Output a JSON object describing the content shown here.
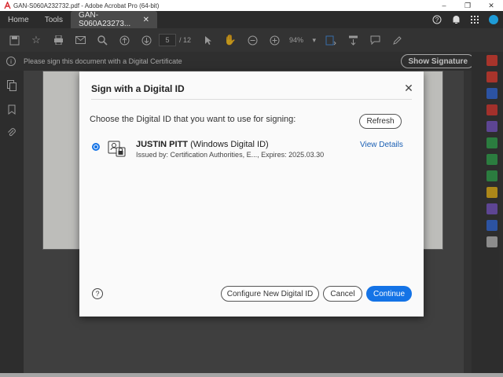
{
  "window": {
    "title": "GAN-S060A232732.pdf - Adobe Acrobat Pro (64-bit)",
    "minimize": "–",
    "maximize": "❐",
    "close": "✕"
  },
  "tabs": {
    "home": "Home",
    "tools": "Tools",
    "document": "GAN-S060A23273...",
    "document_close": "✕"
  },
  "toolbar": {
    "page_current": "5",
    "page_total": "/ 12",
    "zoom": "94%"
  },
  "notification": {
    "message": "Please sign this document with a Digital Certificate",
    "show_signature_label": "Show Signature"
  },
  "dialog": {
    "title": "Sign with a Digital ID",
    "close": "✕",
    "prompt": "Choose the Digital ID that you want to use for signing:",
    "refresh_label": "Refresh",
    "digital_id": {
      "name": "JUSTIN PITT",
      "type": " (Windows Digital ID)",
      "issued": "Issued by: Certification Authorities, E..., Expires: 2025.03.30",
      "view_details": "View Details"
    },
    "help": "?",
    "configure_label": "Configure New Digital ID",
    "cancel_label": "Cancel",
    "continue_label": "Continue"
  },
  "colors": {
    "accent": "#1473e6",
    "link": "#1a5fb4"
  },
  "right_tool_colors": [
    "#e0463a",
    "#e0463a",
    "#3b6fd8",
    "#d9413a",
    "#7c5cc4",
    "#3aa655",
    "#3aa655",
    "#3aa655",
    "#e6b422",
    "#7c5cc4",
    "#3b6fd8",
    "#bbbbbb"
  ]
}
